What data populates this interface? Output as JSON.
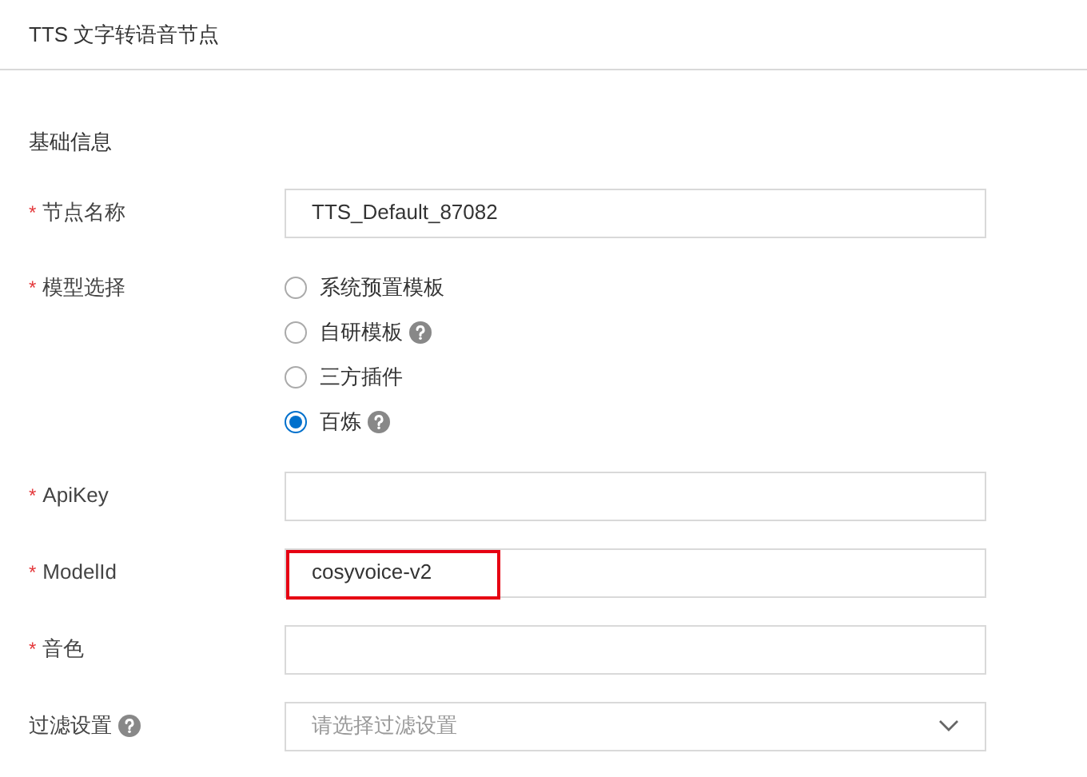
{
  "header": {
    "title": "TTS 文字转语音节点"
  },
  "section": {
    "title": "基础信息"
  },
  "fields": [
    {
      "kind": "input",
      "required_mark": "*",
      "label": "节点名称",
      "value": "TTS_Default_87082"
    },
    {
      "kind": "radio",
      "required_mark": "*",
      "label": "模型选择",
      "options": [
        {
          "label": "系统预置模板",
          "selected": false
        },
        {
          "label": "自研模板",
          "selected": false,
          "help": true
        },
        {
          "label": "三方插件",
          "selected": false
        },
        {
          "label": "百炼",
          "selected": true,
          "help": true
        }
      ]
    },
    {
      "kind": "input",
      "required_mark": "*",
      "label": "ApiKey"
    },
    {
      "kind": "input",
      "required_mark": "*",
      "label": "ModelId",
      "value": "cosyvoice-v2",
      "highlighted": true
    },
    {
      "kind": "input",
      "required_mark": "*",
      "label": "音色"
    },
    {
      "kind": "select",
      "label": "过滤设置",
      "help": true,
      "placeholder": "请选择过滤设置"
    }
  ]
}
